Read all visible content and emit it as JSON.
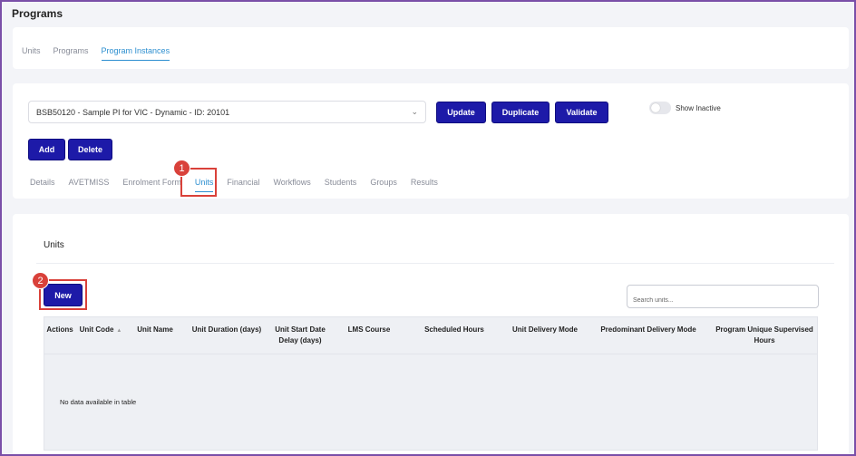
{
  "page": {
    "title": "Programs"
  },
  "top_tabs": [
    {
      "label": "Units",
      "active": false
    },
    {
      "label": "Programs",
      "active": false
    },
    {
      "label": "Program Instances",
      "active": true
    }
  ],
  "instance_select": {
    "value": "BSB50120 - Sample PI for VIC - Dynamic - ID: 20101"
  },
  "actions": {
    "update": "Update",
    "duplicate": "Duplicate",
    "validate": "Validate",
    "add": "Add",
    "delete": "Delete"
  },
  "show_inactive": {
    "label": "Show Inactive",
    "on": false
  },
  "sub_tabs": [
    {
      "label": "Details",
      "active": false
    },
    {
      "label": "AVETMISS",
      "active": false
    },
    {
      "label": "Enrolment Form",
      "active": false
    },
    {
      "label": "Units",
      "active": true
    },
    {
      "label": "Financial",
      "active": false
    },
    {
      "label": "Workflows",
      "active": false
    },
    {
      "label": "Students",
      "active": false
    },
    {
      "label": "Groups",
      "active": false
    },
    {
      "label": "Results",
      "active": false
    }
  ],
  "annotations": {
    "badge1": "1",
    "badge2": "2"
  },
  "units_section": {
    "title": "Units",
    "new_label": "New",
    "search_placeholder": "Search units...",
    "columns": [
      "Actions",
      "Unit Code",
      "Unit Name",
      "Unit Duration (days)",
      "Unit Start Date Delay (days)",
      "LMS Course",
      "Scheduled Hours",
      "Unit Delivery Mode",
      "Predominant Delivery Mode",
      "Program Unique Supervised Hours"
    ],
    "empty_message": "No data available in table"
  },
  "colors": {
    "primary": "#1d1aa8",
    "tab_active": "#2d8fd0",
    "annotation": "#d9413a"
  }
}
